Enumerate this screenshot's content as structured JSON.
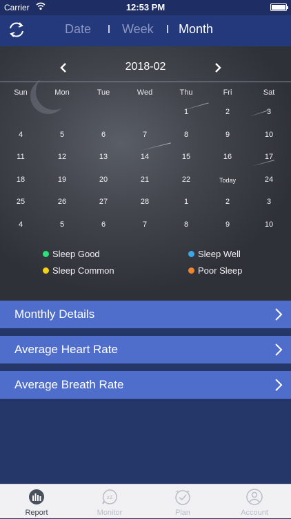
{
  "status": {
    "carrier": "Carrier",
    "time": "12:53 PM"
  },
  "header": {
    "tabs": [
      {
        "label": "Date",
        "active": false
      },
      {
        "label": "Week",
        "active": false
      },
      {
        "label": "Month",
        "active": true
      }
    ],
    "refresh_icon": "refresh-icon"
  },
  "calendar": {
    "month": "2018-02",
    "weekdays": [
      "Sun",
      "Mon",
      "Tue",
      "Wed",
      "Thu",
      "Fri",
      "Sat"
    ],
    "weeks": [
      [
        "",
        "",
        "",
        "",
        "1",
        "2",
        "3"
      ],
      [
        "4",
        "5",
        "6",
        "7",
        "8",
        "9",
        "10"
      ],
      [
        "11",
        "12",
        "13",
        "14",
        "15",
        "16",
        "17"
      ],
      [
        "18",
        "19",
        "20",
        "21",
        "22",
        "Today",
        "24"
      ],
      [
        "25",
        "26",
        "27",
        "28",
        "1",
        "2",
        "3"
      ],
      [
        "4",
        "5",
        "6",
        "7",
        "8",
        "9",
        "10"
      ]
    ]
  },
  "legend": [
    {
      "label": "Sleep Good",
      "color": "#2ee07a"
    },
    {
      "label": "Sleep Well",
      "color": "#3aa8e6"
    },
    {
      "label": "Sleep Common",
      "color": "#f2d21a"
    },
    {
      "label": "Poor Sleep",
      "color": "#f0852a"
    }
  ],
  "rows": [
    {
      "label": "Monthly Details"
    },
    {
      "label": "Average Heart Rate"
    },
    {
      "label": "Average Breath Rate"
    }
  ],
  "tabbar": [
    {
      "label": "Report",
      "icon": "report-icon",
      "active": true
    },
    {
      "label": "Monitor",
      "icon": "monitor-icon",
      "active": false
    },
    {
      "label": "Plan",
      "icon": "plan-icon",
      "active": false
    },
    {
      "label": "Account",
      "icon": "account-icon",
      "active": false
    }
  ],
  "colors": {
    "header": "#24397b",
    "row": "#4f6ecb",
    "background": "#253669"
  }
}
